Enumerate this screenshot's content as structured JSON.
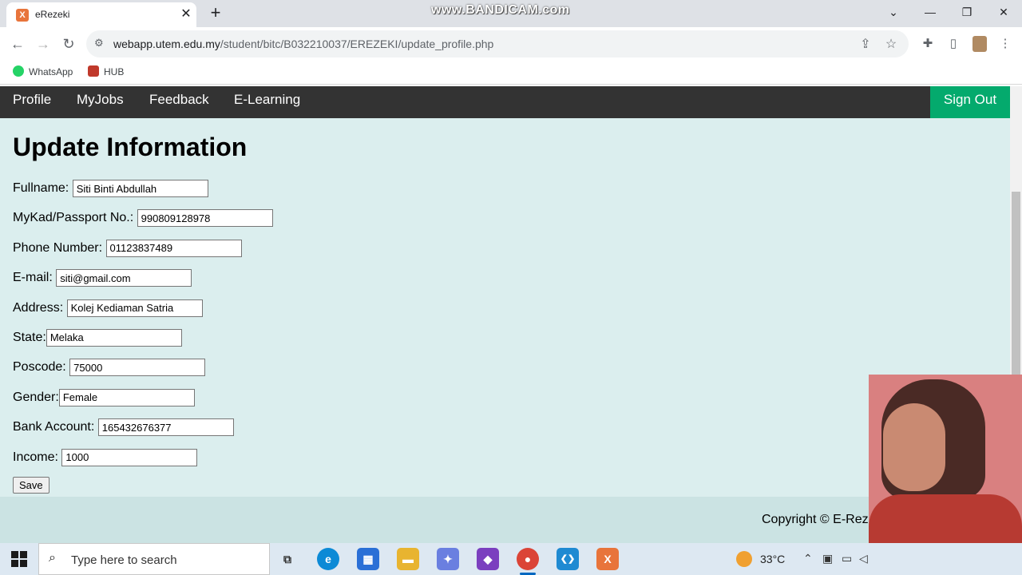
{
  "browser": {
    "tab_title": "eRezeki",
    "tab_favicon": "X",
    "watermark": "www.BANDICAM.com",
    "url_host": "webapp.utem.edu.my",
    "url_path": "/student/bitc/B032210037/EREZEKI/update_profile.php",
    "bookmarks": [
      {
        "label": "WhatsApp",
        "color": "#25d366"
      },
      {
        "label": "HUB",
        "color": "#c0392b"
      }
    ]
  },
  "nav": {
    "items": [
      "Profile",
      "MyJobs",
      "Feedback",
      "E-Learning"
    ],
    "sign_out": "Sign Out",
    "background": "#333333",
    "accent": "#04aa6d"
  },
  "form": {
    "title": "Update Information",
    "fields": [
      {
        "label": "Fullname:",
        "value": "Siti Binti Abdullah"
      },
      {
        "label": "MyKad/Passport No.:",
        "value": "990809128978"
      },
      {
        "label": "Phone Number:",
        "value": "01123837489"
      },
      {
        "label": "E-mail:",
        "value": "siti@gmail.com"
      },
      {
        "label": "Address:",
        "value": "Kolej Kediaman Satria"
      },
      {
        "label": "State:",
        "value": "Melaka"
      },
      {
        "label": "Poscode:",
        "value": "75000"
      },
      {
        "label": "Gender:",
        "value": "Female"
      },
      {
        "label": "Bank Account:",
        "value": "165432676377"
      },
      {
        "label": "Income:",
        "value": "1000"
      }
    ],
    "save_label": "Save"
  },
  "footer": {
    "copyright": "Copyright © E-Rez"
  },
  "taskbar": {
    "search_placeholder": "Type here to search",
    "temperature": "33°C",
    "apps": [
      {
        "name": "task-view",
        "glyph": "⧉",
        "color": "#333333"
      },
      {
        "name": "edge",
        "glyph": "e",
        "color": "#0c8ad6"
      },
      {
        "name": "store",
        "glyph": "▦",
        "color": "#2a6fd6"
      },
      {
        "name": "file-explorer",
        "glyph": "▬",
        "color": "#e8b430"
      },
      {
        "name": "copilot",
        "glyph": "✦",
        "color": "#6a7fe0"
      },
      {
        "name": "visual-studio",
        "glyph": "◆",
        "color": "#7b3fbf"
      },
      {
        "name": "chrome",
        "glyph": "●",
        "color": "#db4437"
      },
      {
        "name": "vscode",
        "glyph": "❮❯",
        "color": "#1f8ad2"
      },
      {
        "name": "xampp",
        "glyph": "X",
        "color": "#e8743b"
      }
    ]
  }
}
